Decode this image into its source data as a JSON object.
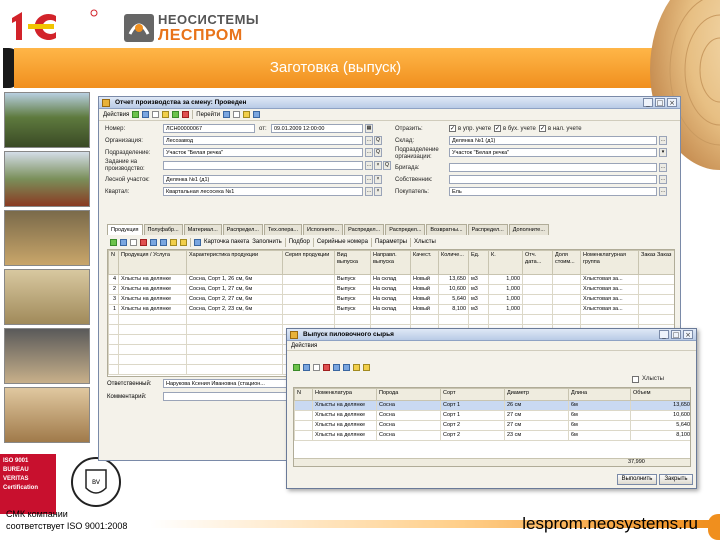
{
  "slide": {
    "title": "Заготовка (выпуск)",
    "logo_neo_line1": "НЕОСИСТЕМЫ",
    "logo_neo_line2": "ЛЕСПРОМ",
    "logo_1c_text": "1С",
    "iso_lines": [
      "ISO 9001",
      "BUREAU VERITAS",
      "Certification"
    ],
    "bv_badge_text": "BUREAU VERITAS 1828",
    "cmk_line1": "СМК компании",
    "cmk_line2": "соответствует ISO 9001:2008",
    "site_url": "lesprom.neosystems.ru",
    "colors": {
      "accent": "#f08f1e",
      "accent_light": "#ffb648",
      "iso_red": "#c8102e"
    }
  },
  "main_window": {
    "title": "Отчет производства за смену: Проведен",
    "toolbar": {
      "actions_label": "Действия",
      "goto_label": "Перейти"
    },
    "fields": {
      "number_label": "Номер:",
      "number_value": "ЛСН00000067",
      "date_prefix": "от:",
      "date_value": "09.01.2009 12:00:00",
      "org_label": "Организация:",
      "org_value": "Лесозавод",
      "subdiv_label": "Подразделение:",
      "subdiv_value": "Участок \"Белая речка\"",
      "task_label": "Задание на производство:",
      "task_value": "",
      "forest_label": "Лесной участок:",
      "forest_value": "Делянка №1 (д1)",
      "quarter_label": "Квартал:",
      "quarter_value": "Квартальная лесосека №1",
      "warehouse_label": "Склад:",
      "warehouse_value": "Делянка №1 (д1)",
      "subdiv_org_label": "Подразделение организации:",
      "subdiv_org_value": "Участок \"Белая речка\"",
      "brigade_label": "Бригада:",
      "brigade_value": "",
      "owner_label": "Собственник:",
      "owner_value": "",
      "buyer_label": "Покупатель:",
      "buyer_value": "Ель",
      "reflect_label": "Отразить:",
      "chk_mgmt": "в упр. учете",
      "chk_acc": "в бух. учете",
      "chk_tax": "в нал. учете"
    },
    "tabs": [
      "Продукция",
      "Полуфабр...",
      "Материал...",
      "Распредел...",
      "Тех.опера...",
      "Исполните...",
      "Распредел...",
      "Распредел...",
      "Возвратны...",
      "Распредел...",
      "Дополните..."
    ],
    "tab_toolbar": {
      "card_label": "Карточка пакета",
      "fill_label": "Заполнить",
      "select_label": "Подбор",
      "serial_label": "Серийные номера",
      "params_label": "Параметры",
      "hlysty_label": "Хлысты"
    },
    "product_table": {
      "headers": [
        "N",
        "Продукция / Услуга",
        "Характеристика продукции",
        "Серия продукции",
        "Вид выпуска",
        "Направл. выпуска",
        "Качест.",
        "Количе...",
        "Ед.",
        "К.",
        "Отч. дата...",
        "Доля стоим...",
        "Номенклатурная группа",
        "Заказ Заказ"
      ],
      "rows": [
        [
          "4",
          "Хлысты на делянке",
          "Сосна, Сорт 1, 26 см, 6м",
          "",
          "Выпуск",
          "На склад",
          "Новый",
          "13,650",
          "м3",
          "1,000",
          "",
          "",
          "Хлыстовая за...",
          ""
        ],
        [
          "2",
          "Хлысты на делянке",
          "Сосна, Сорт 1, 27 см, 6м",
          "",
          "Выпуск",
          "На склад",
          "Новый",
          "10,600",
          "м3",
          "1,000",
          "",
          "",
          "Хлыстовая за...",
          ""
        ],
        [
          "3",
          "Хлысты на делянке",
          "Сосна, Сорт 2, 27 см, 6м",
          "",
          "Выпуск",
          "На склад",
          "Новый",
          "5,640",
          "м3",
          "1,000",
          "",
          "",
          "Хлыстовая за...",
          ""
        ],
        [
          "1",
          "Хлысты на делянке",
          "Сосна, Сорт 2, 23 см, 6м",
          "",
          "Выпуск",
          "На склад",
          "Новый",
          "8,100",
          "м3",
          "1,000",
          "",
          "",
          "Хлыстовая за...",
          ""
        ]
      ]
    },
    "responsible_label": "Ответственный:",
    "responsible_value": "Нарукова Ксения Ивановна (стацион...",
    "comment_label": "Комментарий:",
    "comment_value": ""
  },
  "popup_window": {
    "title": "Выпуск пиловочного сырья",
    "menu_label": "Действия",
    "checkbox_label": "Хлысты",
    "table": {
      "headers": [
        "N",
        "Номенклатура",
        "Порода",
        "Сорт",
        "Диаметр",
        "Длина",
        "Объем"
      ],
      "rows": [
        [
          "",
          "Хлысты на делянке",
          "Сосна",
          "Сорт 1",
          "26 см",
          "6м",
          "13,650"
        ],
        [
          "",
          "Хлысты на делянке",
          "Сосна",
          "Сорт 1",
          "27 см",
          "6м",
          "10,600"
        ],
        [
          "",
          "Хлысты на делянке",
          "Сосна",
          "Сорт 2",
          "27 см",
          "6м",
          "5,640"
        ],
        [
          "",
          "Хлысты на делянке",
          "Сосна",
          "Сорт 2",
          "23 см",
          "6м",
          "8,100"
        ]
      ],
      "total": "37,990"
    },
    "ok_label": "Выполнить",
    "close_label": "Закрыть"
  }
}
